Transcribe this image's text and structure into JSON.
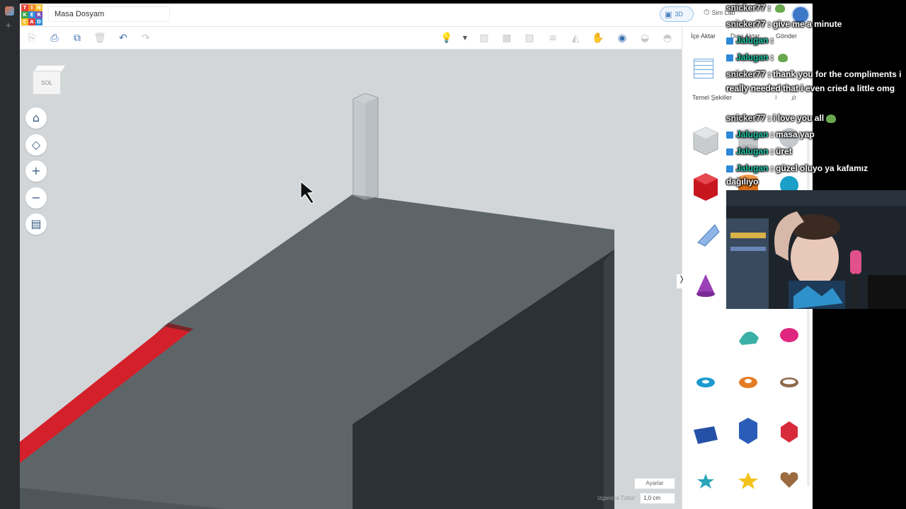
{
  "window": {
    "document_title": "Masa Dosyam",
    "logo_letters": [
      "T",
      "I",
      "N",
      "K",
      "E",
      "R",
      "C",
      "A",
      "D"
    ],
    "view_mode": "3D",
    "sim_lab": "Sim Lab"
  },
  "toolbar": {
    "icons": [
      "copy-icon",
      "paste-icon",
      "duplicate-icon",
      "delete-icon",
      "undo-icon",
      "redo-icon",
      "light-icon",
      "dropdown-icon",
      "note-icon",
      "group-icon",
      "ungroup-icon",
      "align-icon",
      "mirror-icon",
      "cruise-icon",
      "view-icon",
      "hide-icon",
      "show-icon"
    ]
  },
  "viewport": {
    "viewcube_label": "SOL",
    "settings_button": "Ayarlar",
    "snap_label": "Izgaraya Tuttur",
    "snap_value": "1,0 cm"
  },
  "panel": {
    "tabs": [
      "İçe Aktar",
      "Dışa Aktar",
      "Gönder"
    ],
    "shapes_category": "Temel Şekiller",
    "shapes": [
      {
        "name": "box-hole",
        "color": "#bfc3c7"
      },
      {
        "name": "cylinder-hole",
        "color": "#bfc3c7"
      },
      {
        "name": "sphere-hole",
        "color": "#bfc3c7"
      },
      {
        "name": "box",
        "color": "#d9262e"
      },
      {
        "name": "cylinder",
        "color": "#e07a22"
      },
      {
        "name": "sphere",
        "color": "#1aa0c8"
      },
      {
        "name": "scribble",
        "color": "#5c8fd0"
      },
      {
        "name": "cone",
        "color": "#9b3fb8"
      },
      {
        "name": "text",
        "color": "#cc2f2f"
      },
      {
        "name": "roof",
        "color": "#3ab0a6"
      },
      {
        "name": "paraboloid",
        "color": "#e0277f"
      },
      {
        "name": "torus",
        "color": "#1b9bd0"
      },
      {
        "name": "tube",
        "color": "#e57c23"
      },
      {
        "name": "ring",
        "color": "#8c6a4a"
      },
      {
        "name": "wedge",
        "color": "#2550a8"
      },
      {
        "name": "polygon",
        "color": "#2a5cb8"
      },
      {
        "name": "icosahedron",
        "color": "#d72a3a"
      },
      {
        "name": "star",
        "color": "#2aa5b8"
      },
      {
        "name": "star-yellow",
        "color": "#f2c21a"
      },
      {
        "name": "heart",
        "color": "#9b6a3f"
      }
    ]
  },
  "chat": [
    {
      "user": "snicker77",
      "message": "",
      "color": "silver"
    },
    {
      "user": "snicker77",
      "message": "give me a minute",
      "color": "silver"
    },
    {
      "user": "Jalugan",
      "message": "",
      "color": "teal"
    },
    {
      "user": "Jalugan",
      "message": "",
      "color": "teal"
    },
    {
      "user": "snicker77",
      "message": "thank you for the compliments i",
      "color": "silver"
    },
    {
      "user": "",
      "message": "really needed that i even cried a little omg",
      "color": "silver"
    },
    {
      "user": "snicker77",
      "message": "i love you all",
      "color": "silver"
    },
    {
      "user": "Jalugan",
      "message": "masa yap",
      "color": "teal"
    },
    {
      "user": "Jalugan",
      "message": "üret",
      "color": "teal"
    },
    {
      "user": "Jalugan",
      "message": "güzel oluyo ya kafamız",
      "color": "teal"
    },
    {
      "user": "",
      "message": "dağılıyo",
      "color": "teal"
    }
  ],
  "colors": {
    "tabletop": "#5e6568",
    "table_side": "#2d3236",
    "viewport_bg": "#d2d6d9",
    "accent": "#3a6fb3",
    "red_strip": "#d4202a"
  }
}
